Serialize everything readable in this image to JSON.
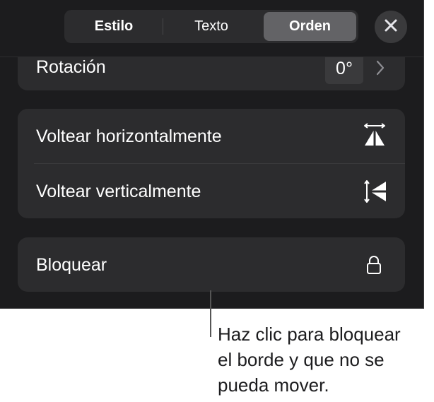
{
  "tabs": [
    {
      "label": "Estilo",
      "selected": false
    },
    {
      "label": "Texto",
      "selected": false
    },
    {
      "label": "Orden",
      "selected": true
    }
  ],
  "close": {
    "icon": "close-icon"
  },
  "rotation": {
    "label": "Rotación",
    "value": "0°",
    "chevron_icon": "chevron-right-icon"
  },
  "flip": {
    "horizontal_label": "Voltear horizontalmente",
    "horizontal_icon": "flip-horizontal-icon",
    "vertical_label": "Voltear verticalmente",
    "vertical_icon": "flip-vertical-icon"
  },
  "lock": {
    "label": "Bloquear",
    "icon": "lock-icon"
  },
  "callout": {
    "line1": "Haz clic para bloquear",
    "line2": "el borde y que no se",
    "line3": "pueda mover."
  },
  "colors": {
    "panel_background": "#1c1c1e",
    "group_background": "#2c2c2e",
    "selected_tab": "#636366",
    "text_light": "#ffffff",
    "callout_text": "#1c1c1e"
  }
}
